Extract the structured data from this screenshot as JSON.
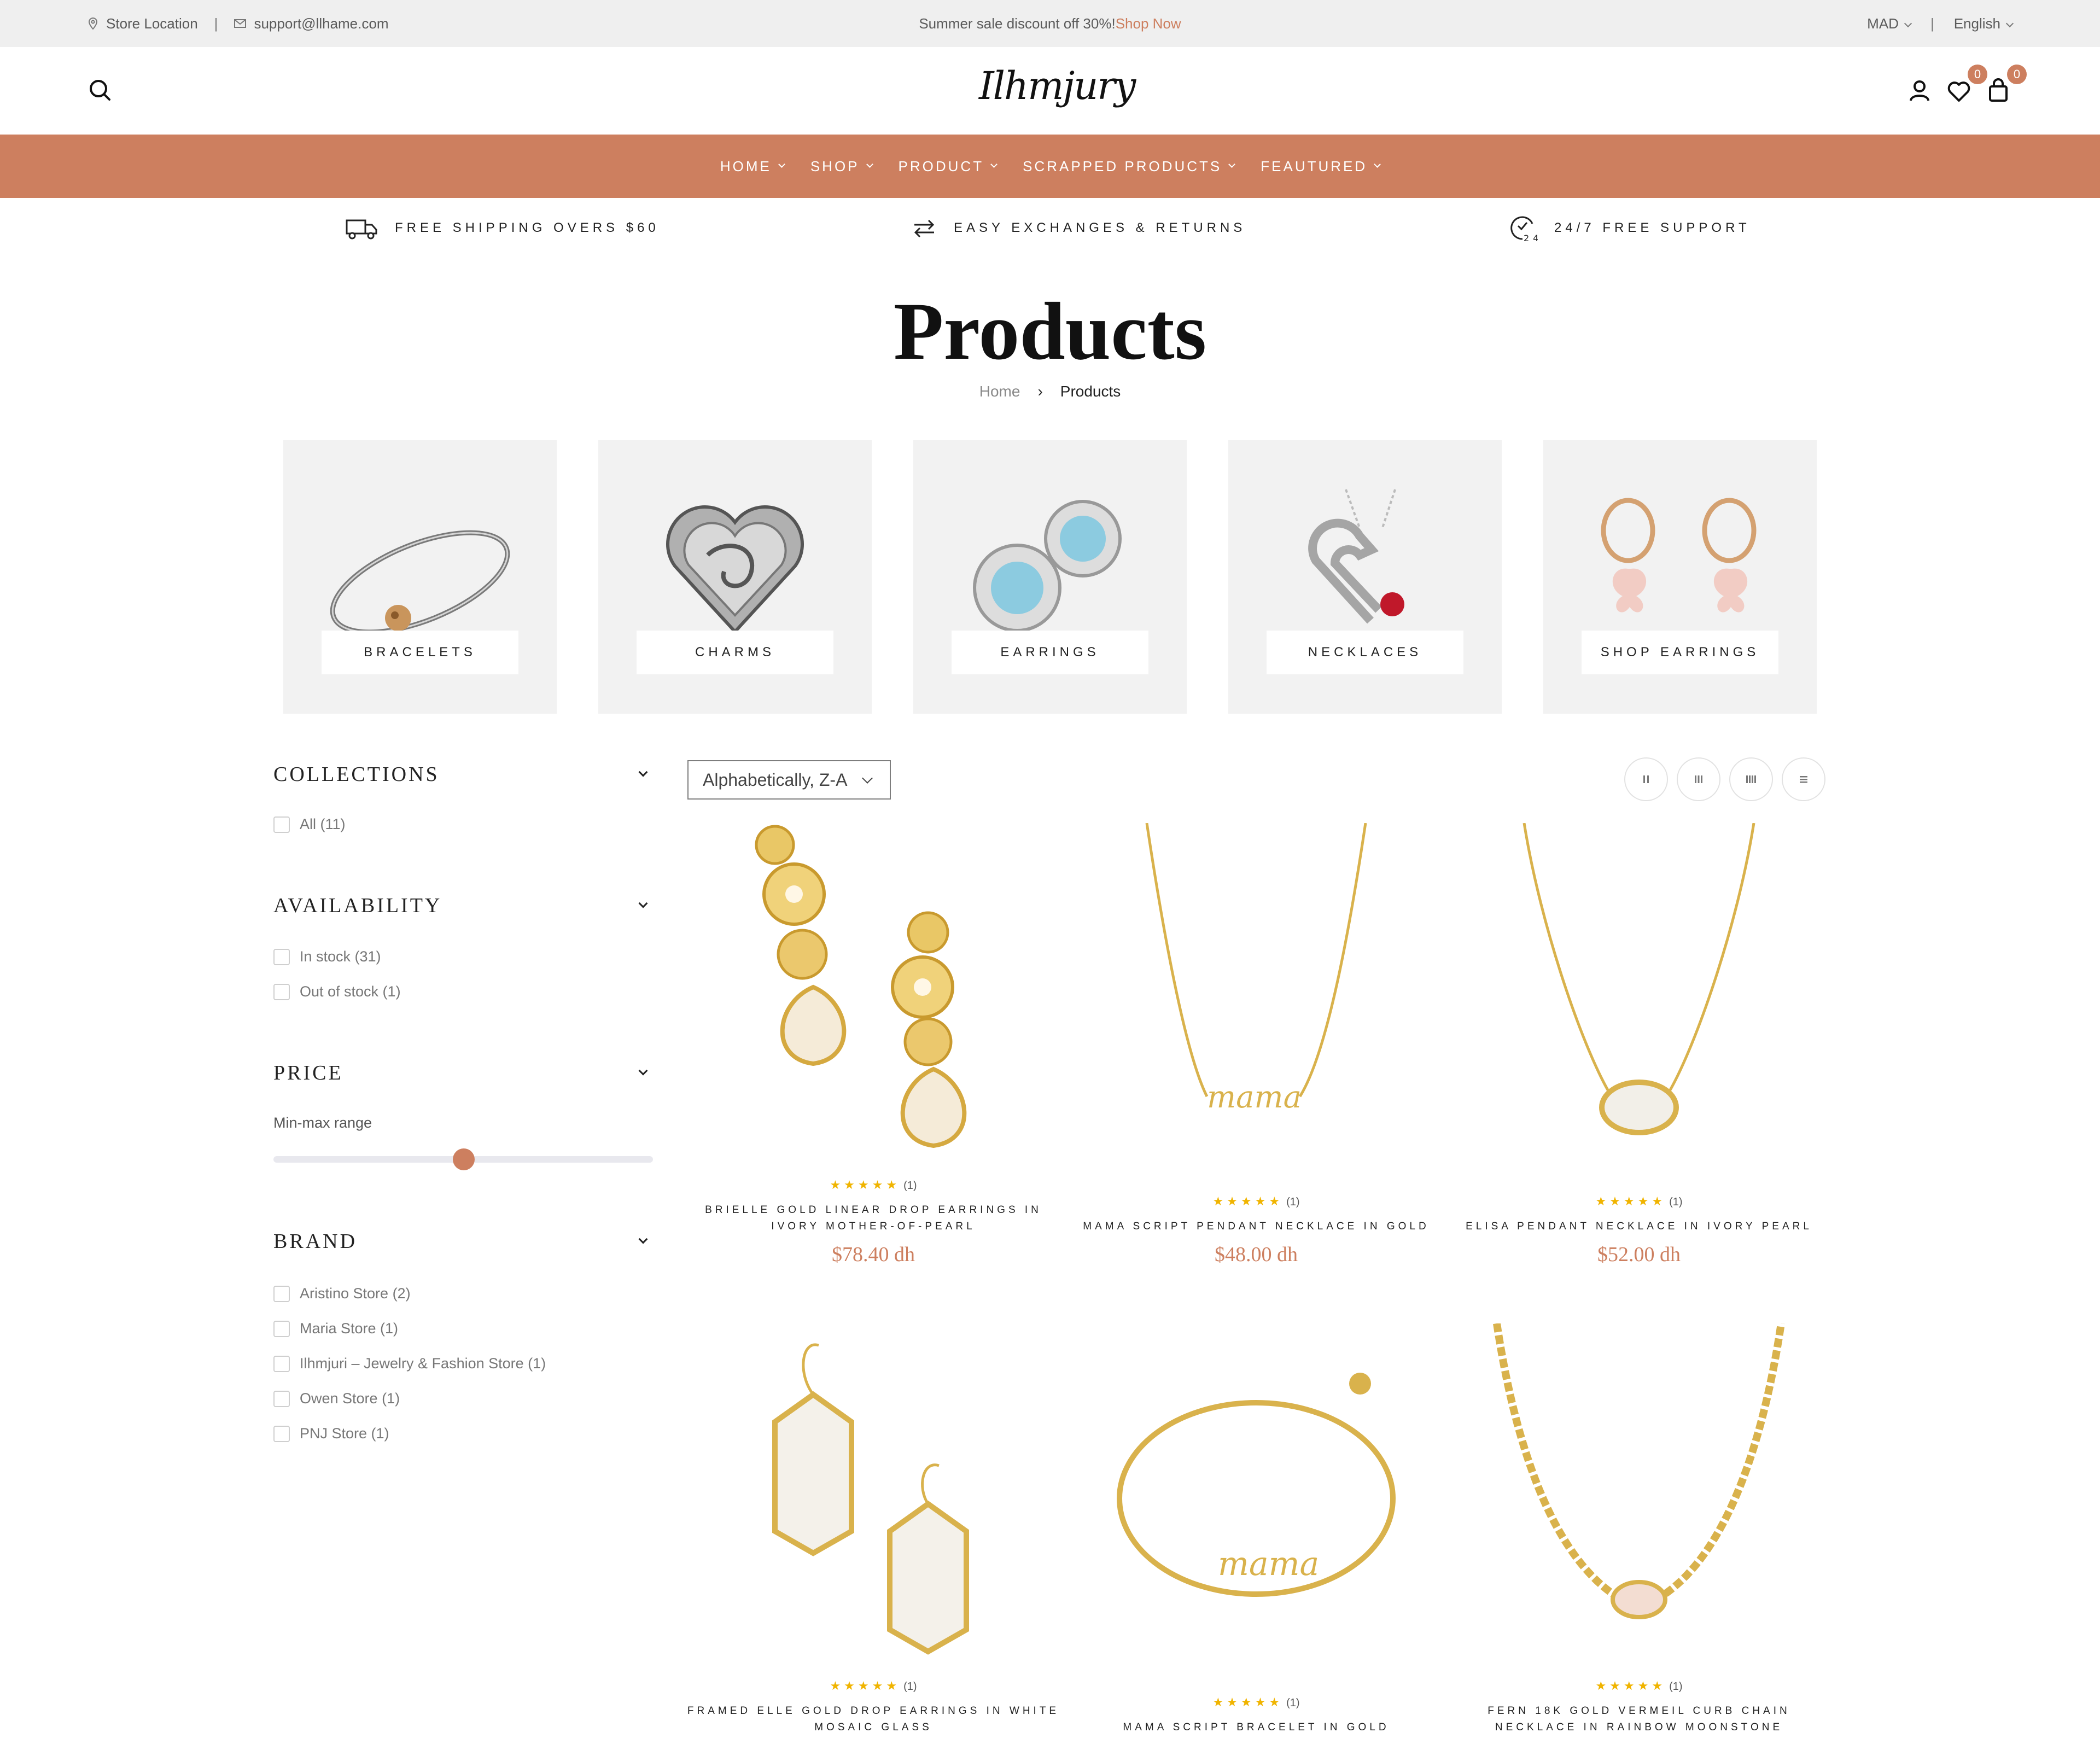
{
  "topbar": {
    "store_location": "Store Location",
    "email": "support@llhame.com",
    "announcement": "Summer sale discount off 30%!",
    "shop_now": "Shop Now",
    "currency": "MAD",
    "language": "English",
    "separator": "|"
  },
  "header": {
    "logo": "Ilhmjury",
    "wishlist_count": "0",
    "cart_count": "0"
  },
  "nav": {
    "items": [
      "HOME",
      "SHOP",
      "PRODUCT",
      "SCRAPPED PRODUCTS",
      "FEAUTURED"
    ]
  },
  "features": [
    {
      "icon": "truck-icon",
      "label": "FREE SHIPPING OVERS $60"
    },
    {
      "icon": "exchange-arrows-icon",
      "label": "EASY EXCHANGES & RETURNS"
    },
    {
      "icon": "support-24-icon",
      "label": "24/7 FREE SUPPORT"
    }
  ],
  "page": {
    "title": "Products",
    "breadcrumb_home": "Home",
    "breadcrumb_arrow": "›",
    "breadcrumb_current": "Products"
  },
  "categories": [
    {
      "label": "BRACELETS"
    },
    {
      "label": "CHARMS"
    },
    {
      "label": "EARRINGS"
    },
    {
      "label": "NECKLACES"
    },
    {
      "label": "SHOP EARRINGS"
    }
  ],
  "filters": {
    "collections": {
      "title": "COLLECTIONS",
      "options": [
        "All (11)"
      ]
    },
    "availability": {
      "title": "AVAILABILITY",
      "options": [
        "In stock (31)",
        "Out of stock (1)"
      ]
    },
    "price": {
      "title": "PRICE",
      "range_label": "Min-max range",
      "slider_level": 0.5
    },
    "brand": {
      "title": "BRAND",
      "options": [
        "Aristino Store (2)",
        "Maria Store (1)",
        "Ilhmjuri – Jewelry & Fashion Store (1)",
        "Owen Store (1)",
        "PNJ Store (1)"
      ]
    }
  },
  "toolbar": {
    "sort_value": "Alphabetically, Z-A",
    "layout_buttons": [
      "two-column-icon",
      "three-column-icon",
      "four-column-icon",
      "list-view-icon"
    ]
  },
  "products": [
    {
      "name": "BRIELLE GOLD LINEAR DROP EARRINGS IN IVORY MOTHER-OF-PEARL",
      "price": "$78.40 dh",
      "stars": "★★★★★",
      "reviews": "(1)"
    },
    {
      "name": "MAMA SCRIPT PENDANT NECKLACE IN GOLD",
      "price": "$48.00 dh",
      "stars": "★★★★★",
      "reviews": "(1)"
    },
    {
      "name": "ELISA PENDANT NECKLACE IN IVORY PEARL",
      "price": "$52.00 dh",
      "stars": "★★★★★",
      "reviews": "(1)"
    },
    {
      "name": "FRAMED ELLE GOLD DROP EARRINGS IN WHITE MOSAIC GLASS",
      "price": "",
      "stars": "★★★★★",
      "reviews": "(1)"
    },
    {
      "name": "MAMA SCRIPT BRACELET IN GOLD",
      "price": "",
      "stars": "★★★★★",
      "reviews": "(1)"
    },
    {
      "name": "FERN 18K GOLD VERMEIL CURB CHAIN NECKLACE IN RAINBOW MOONSTONE",
      "price": "",
      "stars": "★★★★★",
      "reviews": "(1)"
    }
  ],
  "colors": {
    "accent": "#cd7f5f",
    "star": "#f0b400",
    "topbar_bg": "#efefef",
    "category_bg": "#f2f2f2"
  }
}
